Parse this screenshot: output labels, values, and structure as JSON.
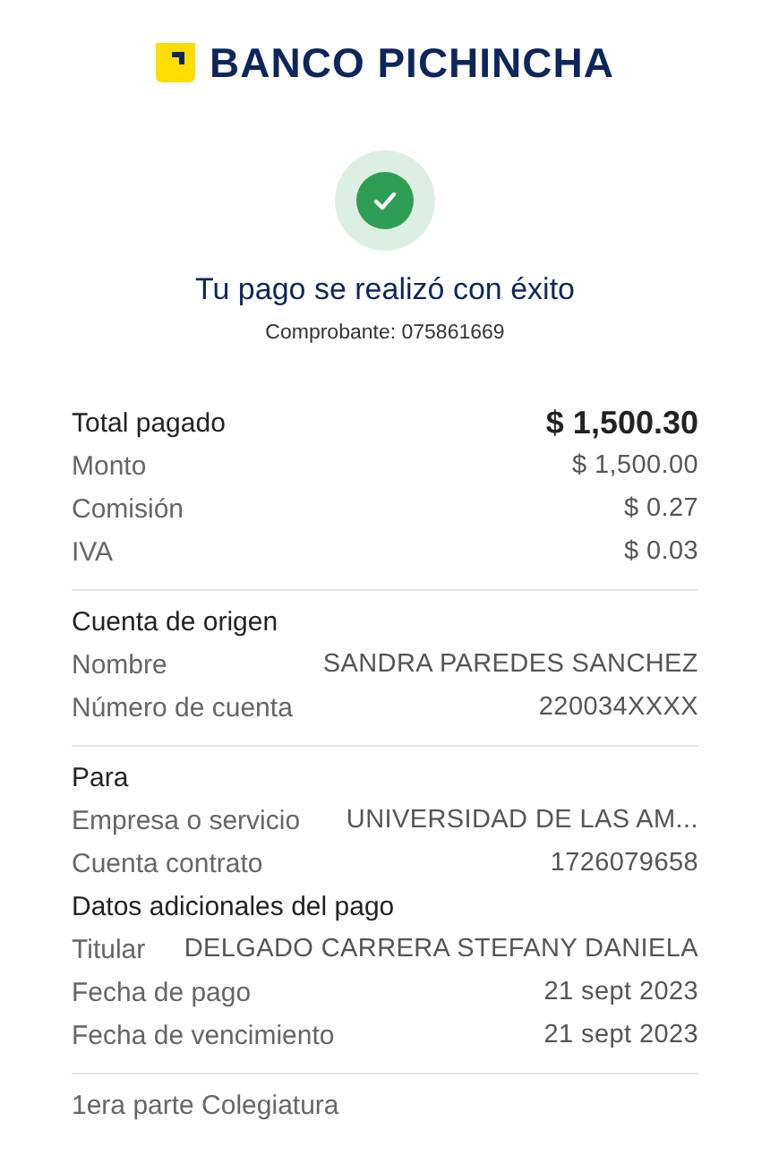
{
  "brand": {
    "name": "BANCO PICHINCHA"
  },
  "status": {
    "title": "Tu pago se realizó con éxito",
    "receipt": "Comprobante: 075861669"
  },
  "sections": [
    {
      "rows": [
        {
          "kind": "total",
          "label": "Total pagado",
          "value": "$ 1,500.30"
        },
        {
          "kind": "row",
          "label": "Monto",
          "value": "$ 1,500.00"
        },
        {
          "kind": "row",
          "label": "Comisión",
          "value": "$ 0.27"
        },
        {
          "kind": "row",
          "label": "IVA",
          "value": "$ 0.03"
        }
      ]
    },
    {
      "rows": [
        {
          "kind": "heading",
          "label": "Cuenta de origen"
        },
        {
          "kind": "row",
          "label": "Nombre",
          "value": "SANDRA PAREDES SANCHEZ"
        },
        {
          "kind": "row",
          "label": "Número de cuenta",
          "value": "220034XXXX"
        }
      ]
    },
    {
      "rows": [
        {
          "kind": "heading",
          "label": "Para"
        },
        {
          "kind": "row",
          "label": "Empresa o servicio",
          "value": "UNIVERSIDAD DE LAS AM..."
        },
        {
          "kind": "row",
          "label": "Cuenta contrato",
          "value": "1726079658"
        },
        {
          "kind": "heading",
          "label": "Datos adicionales del pago"
        },
        {
          "kind": "row",
          "label": "Titular",
          "value": "DELGADO CARRERA STEFANY DANIELA"
        },
        {
          "kind": "row",
          "label": "Fecha de pago",
          "value": "21 sept 2023"
        },
        {
          "kind": "row",
          "label": "Fecha de vencimiento",
          "value": "21 sept 2023"
        }
      ]
    },
    {
      "rows": [
        {
          "kind": "note",
          "label": "1era parte Colegiatura"
        }
      ]
    }
  ]
}
